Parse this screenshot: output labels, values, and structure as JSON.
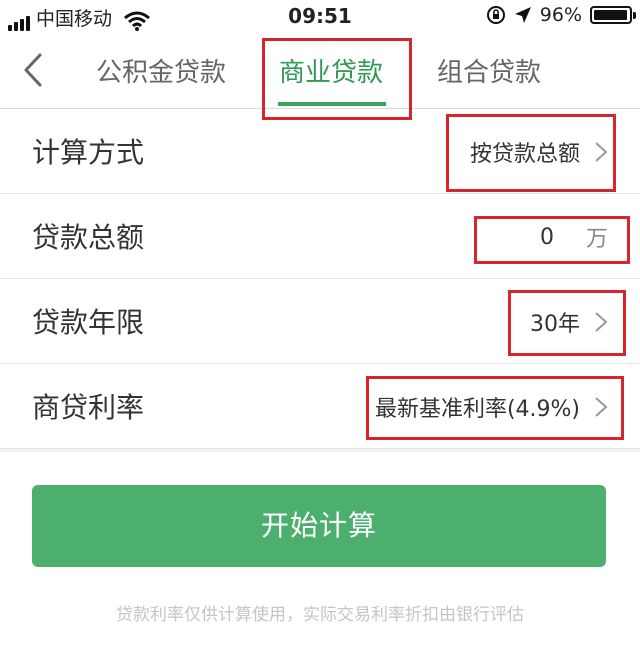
{
  "status_bar": {
    "carrier": "中国移动",
    "time": "09:51",
    "battery": "96%",
    "battery_level": 0.96
  },
  "tabs": [
    {
      "label": "公积金贷款",
      "active": false
    },
    {
      "label": "商业贷款",
      "active": true
    },
    {
      "label": "组合贷款",
      "active": false
    }
  ],
  "form": {
    "method": {
      "label": "计算方式",
      "value": "按贷款总额"
    },
    "amount": {
      "label": "贷款总额",
      "value": "0",
      "unit": "万"
    },
    "term": {
      "label": "贷款年限",
      "value": "30年"
    },
    "rate": {
      "label": "商贷利率",
      "value": "最新基准利率(4.9%)"
    }
  },
  "button": {
    "label": "开始计算"
  },
  "note": "贷款利率仅供计算使用，实际交易利率折扣由银行评估",
  "colors": {
    "accent": "#2f9a55",
    "button": "#4caf6e",
    "highlight": "#d9242d"
  },
  "icons": [
    "signal-icon",
    "wifi-icon",
    "rotation-lock-icon",
    "location-arrow-icon",
    "battery-icon",
    "back-arrow-icon",
    "chevron-right-icon"
  ]
}
